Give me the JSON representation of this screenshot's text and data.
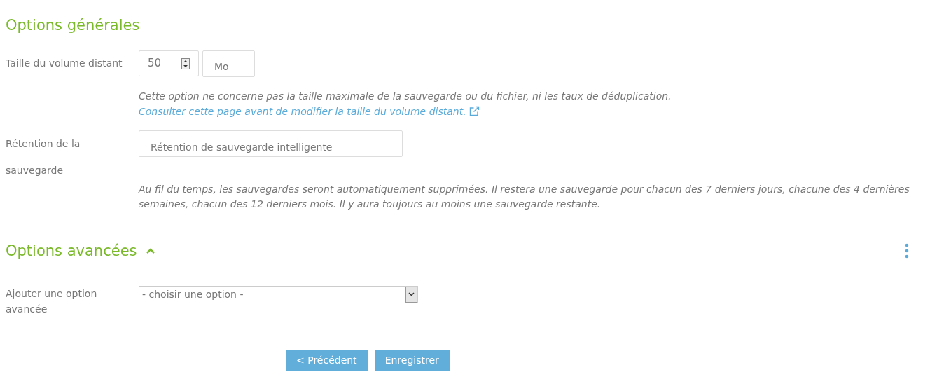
{
  "general": {
    "title": "Options générales",
    "volume": {
      "label": "Taille du volume distant",
      "value": "50",
      "unit": "Mo",
      "help": "Cette option ne concerne pas la taille maximale de la sauvegarde ou du fichier, ni les taux de déduplication.",
      "link": "Consulter cette page avant de modifier la taille du volume distant."
    },
    "retention": {
      "label": "Rétention de la sauvegarde",
      "value": "Rétention de sauvegarde intelligente",
      "help": "Au fil du temps, les sauvegardes seront automatiquement supprimées. Il restera une sauvegarde pour chacun des 7 derniers jours, chacune des 4 dernières semaines, chacun des 12 derniers mois. Il y aura toujours au moins une sauvegarde restante."
    }
  },
  "advanced": {
    "title": "Options avancées",
    "expanded": true,
    "add_label": "Ajouter une option avancée",
    "select_value": "- choisir une option -"
  },
  "buttons": [
    "< Précédent",
    "Enregistrer"
  ]
}
